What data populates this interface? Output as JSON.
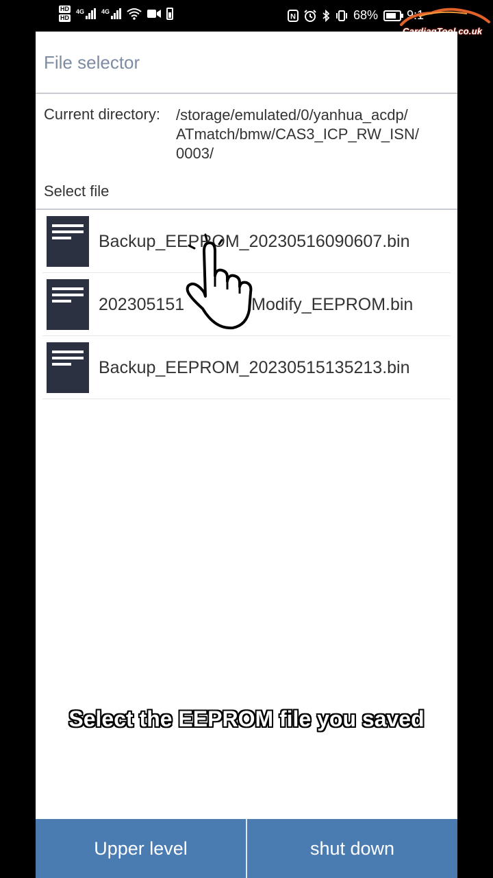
{
  "status_bar": {
    "battery_percent": "68%",
    "time": "9:1",
    "hd_labels": [
      "HD",
      "HD"
    ],
    "network_labels": [
      "4G",
      "4G"
    ],
    "nfc_label": "N"
  },
  "watermark": {
    "text": "CardiagTool.co.uk"
  },
  "header": {
    "title": "File selector"
  },
  "directory": {
    "label": "Current directory:",
    "path_lines": [
      "/storage/emulated/0/yanhua_acdp/",
      "ATmatch/bmw/CAS3_ICP_RW_ISN/",
      "0003/"
    ]
  },
  "file_section": {
    "label": "Select file"
  },
  "files": [
    {
      "name": "Backup_EEPROM_20230516090607.bin",
      "icon": "document-icon"
    },
    {
      "name": "20230515135221_Modify_EEPROM.bin",
      "icon": "document-icon",
      "visible_text": [
        "202305151",
        "Modify_EEPROM.bin"
      ]
    },
    {
      "name": "Backup_EEPROM_20230515135213.bin",
      "icon": "document-icon"
    }
  ],
  "caption": "Select the EEPROM file you saved",
  "buttons": {
    "upper_level": "Upper level",
    "shut_down": "shut down"
  },
  "colors": {
    "title": "#7d8ba3",
    "button_bg": "#4a7cb2",
    "icon_bg": "#2b3140"
  }
}
